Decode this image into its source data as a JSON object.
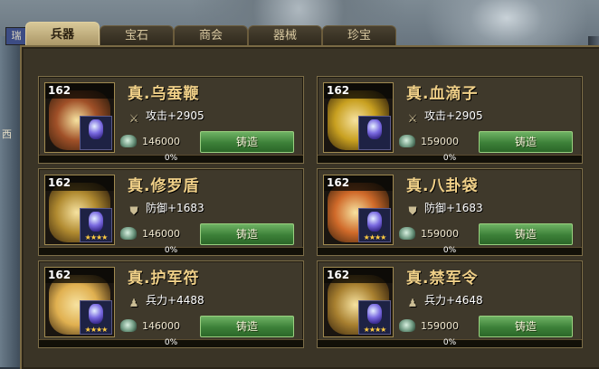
{
  "tabs": [
    {
      "label": "兵器",
      "active": true
    },
    {
      "label": "宝石",
      "active": false
    },
    {
      "label": "商会",
      "active": false
    },
    {
      "label": "器械",
      "active": false
    },
    {
      "label": "珍宝",
      "active": false
    }
  ],
  "side_badge": "瑞",
  "side_label": "西",
  "items": [
    {
      "level": "162",
      "name": "真.乌蚕鞭",
      "stat_icon": "sword-icon",
      "stat": "攻击+2905",
      "cost": "146000",
      "forge": "铸造",
      "progress": "0%",
      "progress_value": 0,
      "stars": "",
      "art_color": "#a05028"
    },
    {
      "level": "162",
      "name": "真.血滴子",
      "stat_icon": "sword-icon",
      "stat": "攻击+2905",
      "cost": "159000",
      "forge": "铸造",
      "progress": "0%",
      "progress_value": 0,
      "stars": "",
      "art_color": "#c8a020"
    },
    {
      "level": "162",
      "name": "真.修罗盾",
      "stat_icon": "shield-icon",
      "stat": "防御+1683",
      "cost": "146000",
      "forge": "铸造",
      "progress": "0%",
      "progress_value": 0,
      "stars": "★★★★",
      "art_color": "#b08a30"
    },
    {
      "level": "162",
      "name": "真.八卦袋",
      "stat_icon": "shield-icon",
      "stat": "防御+1683",
      "cost": "159000",
      "forge": "铸造",
      "progress": "0%",
      "progress_value": 0,
      "stars": "★★★★",
      "art_color": "#d06a2a"
    },
    {
      "level": "162",
      "name": "真.护军符",
      "stat_icon": "soldier-icon",
      "stat": "兵力+4488",
      "cost": "146000",
      "forge": "铸造",
      "progress": "0%",
      "progress_value": 0,
      "stars": "★★★★",
      "art_color": "#e0b050"
    },
    {
      "level": "162",
      "name": "真.禁军令",
      "stat_icon": "soldier-icon",
      "stat": "兵力+4648",
      "cost": "159000",
      "forge": "铸造",
      "progress": "0%",
      "progress_value": 0,
      "stars": "★★★★",
      "art_color": "#a88030"
    }
  ],
  "colors": {
    "accent": "#f0d088",
    "button": "#3c8038"
  }
}
